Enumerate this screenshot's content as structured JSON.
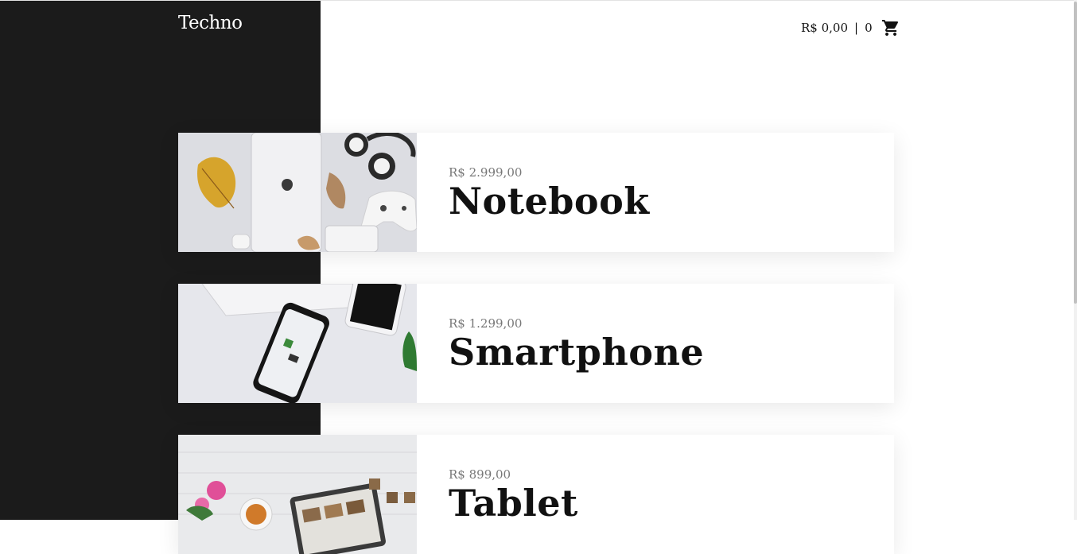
{
  "header": {
    "logo": "Techno",
    "cart_total": "R$ 0,00",
    "cart_separator": "|",
    "cart_count": "0",
    "cart_icon": "shopping-cart-icon"
  },
  "products": [
    {
      "price": "R$ 2.999,00",
      "name": "Notebook"
    },
    {
      "price": "R$ 1.299,00",
      "name": "Smartphone"
    },
    {
      "price": "R$ 899,00",
      "name": "Tablet"
    }
  ],
  "colors": {
    "dark_panel": "#1b1b1b",
    "text": "#111111",
    "price": "#777777"
  }
}
